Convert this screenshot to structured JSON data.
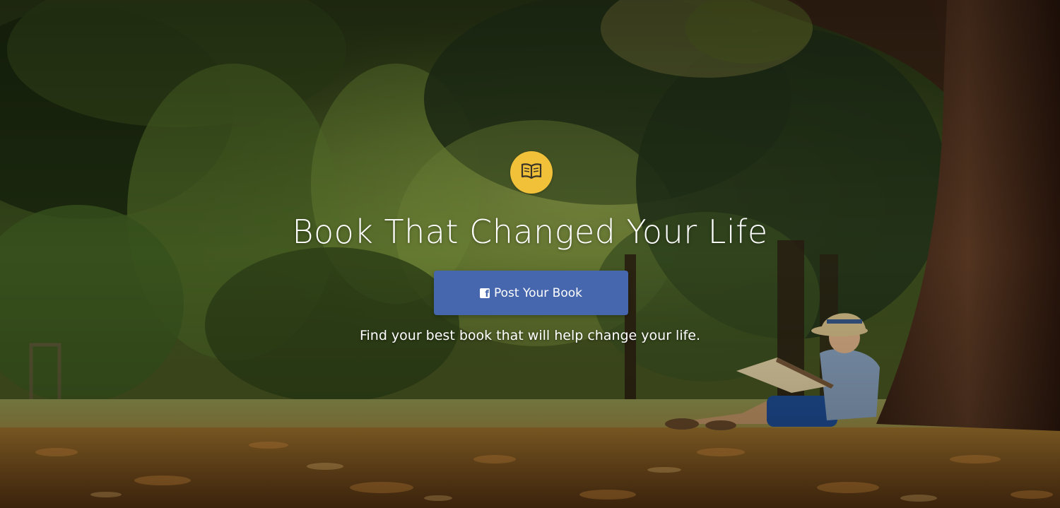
{
  "hero": {
    "icon": "open-book-icon",
    "title": "Book That Changed Your Life",
    "cta_label": "Post Your Book",
    "cta_icon": "facebook-icon",
    "tagline": "Find your best book that will help change your life."
  },
  "colors": {
    "badge": "#f2c13a",
    "cta": "#4667ae",
    "text": "#ffffff"
  }
}
